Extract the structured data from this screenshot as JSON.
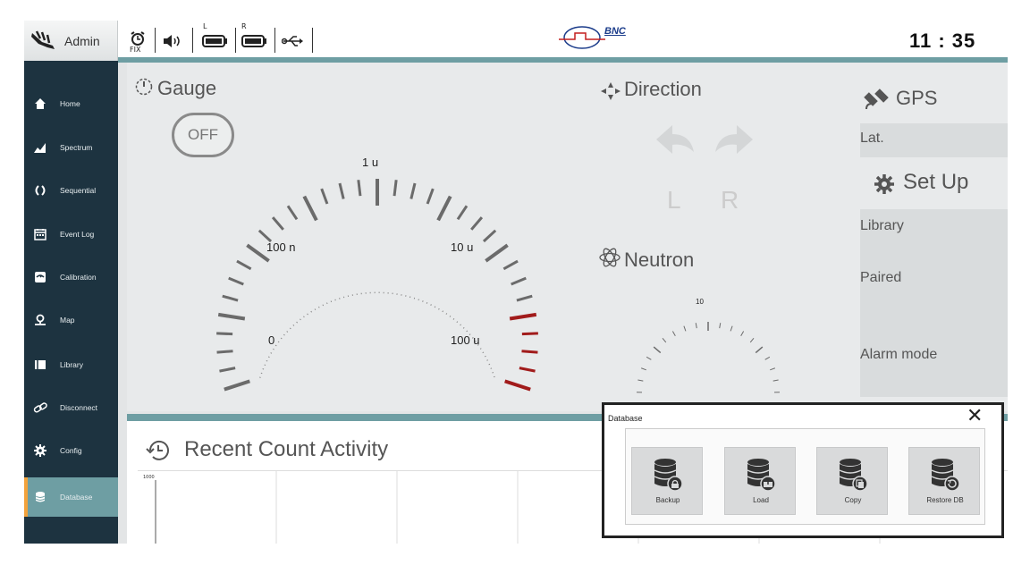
{
  "topbar": {
    "user_label": "Admin",
    "fix_label": "FIX",
    "left_label": "L",
    "right_label": "R",
    "brand": "BNC",
    "clock": "11 : 35"
  },
  "sidebar": {
    "items": [
      {
        "label": "Home",
        "icon": "home-icon"
      },
      {
        "label": "Spectrum",
        "icon": "spectrum-icon"
      },
      {
        "label": "Sequential",
        "icon": "sequential-icon"
      },
      {
        "label": "Event Log",
        "icon": "calendar-icon"
      },
      {
        "label": "Calibration",
        "icon": "calibration-icon"
      },
      {
        "label": "Map",
        "icon": "map-pin-icon"
      },
      {
        "label": "Library",
        "icon": "library-icon"
      },
      {
        "label": "Disconnect",
        "icon": "link-icon"
      },
      {
        "label": "Config",
        "icon": "gear-icon"
      },
      {
        "label": "Database",
        "icon": "database-icon",
        "active": true
      }
    ]
  },
  "gauge": {
    "title": "Gauge",
    "off_label": "OFF",
    "scale_labels": [
      "0",
      "100 n",
      "1 u",
      "10 u",
      "100 u"
    ]
  },
  "direction": {
    "title": "Direction",
    "left": "L",
    "right": "R"
  },
  "neutron": {
    "title": "Neutron",
    "scale_label": "10"
  },
  "gps": {
    "title": "GPS",
    "lat_label": "Lat."
  },
  "setup": {
    "title": "Set Up",
    "library_label": "Library",
    "paired_label": "Paired",
    "alarm_label": "Alarm mode"
  },
  "recent": {
    "title": "Recent Count Activity",
    "y_max": "1000"
  },
  "modal": {
    "title": "Database",
    "buttons": [
      {
        "label": "Backup",
        "icon": "database-lock-icon"
      },
      {
        "label": "Load",
        "icon": "database-load-icon"
      },
      {
        "label": "Copy",
        "icon": "database-copy-icon"
      },
      {
        "label": "Restore DB",
        "icon": "database-restore-icon"
      }
    ]
  },
  "colors": {
    "sidebar_bg": "#1d3340",
    "accent": "#6e9ea3",
    "active_marker": "#f2a23c",
    "gauge_danger": "#a11b1b"
  }
}
